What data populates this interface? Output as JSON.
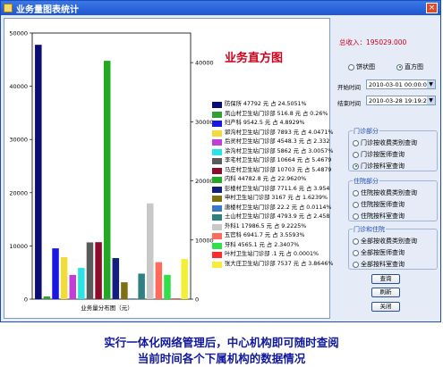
{
  "window": {
    "title": "业务量图表统计",
    "close_glyph": "×"
  },
  "chart_data": {
    "type": "bar",
    "title": "业务直方图",
    "xlabel": "业务量分布图（元）",
    "ylim": [
      0,
      50000
    ],
    "left_ticks": [
      "0",
      "10000",
      "20000",
      "30000",
      "40000",
      "50000"
    ],
    "right_ticks": [
      "0",
      "10000",
      "20000",
      "30000",
      "40000"
    ],
    "categories": [
      "防保所",
      "凤山村卫生站门诊部",
      "妇产科",
      "郭沟村卫生站门诊部",
      "后灵村卫生站门诊部",
      "涂沟村卫生站门诊部",
      "李宅村卫生站门诊部",
      "马庄村卫生站门诊部",
      "内科",
      "彭楼村卫生站门诊部",
      "申村卫生站门诊部",
      "唐楼村卫生站门诊部",
      "土山村卫生站门诊部",
      "外科1",
      "五官科",
      "牙科",
      "叶村卫生站门诊部",
      "张大庄卫生站门诊部"
    ],
    "values": [
      47792,
      516.8,
      9542.5,
      7893,
      4548.3,
      5862,
      10664,
      10703,
      44782.8,
      7711.6,
      3167,
      22.2,
      4793.9,
      17986.5,
      6941.7,
      4565.1,
      1,
      7537
    ],
    "colors": [
      "#0c0c78",
      "#33a033",
      "#1818e0",
      "#f0dc3c",
      "#c23ed8",
      "#28e4e4",
      "#5a5a5a",
      "#8c0c2a",
      "#22a822",
      "#121e80",
      "#7f7010",
      "#3878c8",
      "#308080",
      "#c8c8c8",
      "#ff6a5a",
      "#30e048",
      "#ff2a2a",
      "#f4ee38"
    ],
    "legend": [
      "防保所  47792 元 占 24.5051%",
      "凤山村卫生站门诊部  516.8 元 占 0.26%",
      "妇产科  9542.5 元 占 4.8929%",
      "郭沟村卫生站门诊部  7893 元 占 4.0471%",
      "后灵村卫生站门诊部  4548.3 元 占 2.332",
      "涂沟村卫生站门诊部  5862 元 占 3.0057%",
      "李宅村卫生站门诊部  10664 元 占 5.4679",
      "马庄村卫生站门诊部  10703 元 占 5.4879",
      "内科  44782.8 元 占 22.9620%",
      "彭楼村卫生站门诊部  7711.6 元 占 3.954",
      "申村卫生站门诊部  3167 元 占 1.6239%",
      "唐楼村卫生站门诊部  22.2 元 占 0.0114%",
      "土山村卫生站门诊部  4793.9 元 占 2.458",
      "外科1  17986.5 元 占 9.2225%",
      "五官科  6941.7 元 占 3.5593%",
      "牙科  4565.1 元 占 2.3407%",
      "叶村卫生站门诊部  .1 元 占 0.0001%",
      "张大庄卫生站门诊部  7537 元 占 3.8646%"
    ]
  },
  "side": {
    "total": "总收入：195029.000",
    "pie_label": "饼状图",
    "bar_label": "直方图",
    "start_label": "开始时间",
    "start_value": "2010-03-01  00:00:00",
    "end_label": "结束时间",
    "end_value": "2010-03-28  19:19:27",
    "outpatient_title": "门诊部分",
    "outpatient": [
      "门诊按收费类别查询",
      "门诊按医师查询",
      "门诊按科室查询"
    ],
    "inpatient_title": "住院部分",
    "inpatient": [
      "住院按收费类别查询",
      "住院按医师查询",
      "住院按科室查询"
    ],
    "both_title": "门诊和住院",
    "both": [
      "全部按收费类别查询",
      "全部按医师查询",
      "全部按科室查询"
    ],
    "query_btn": "查询",
    "refresh_btn": "刷新",
    "close_btn": "关闭"
  },
  "caption": {
    "line1": "实行一体化网络管理后，中心机构即可随时查阅",
    "line2": "当前时间各个下属机构的数据情况"
  }
}
